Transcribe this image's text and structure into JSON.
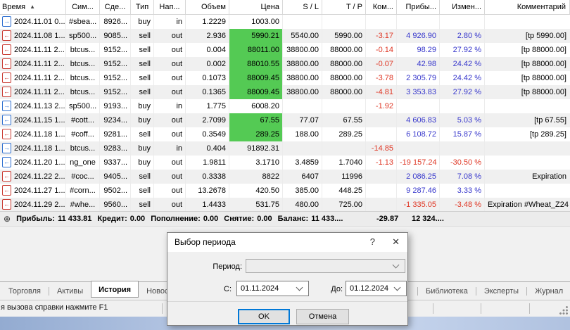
{
  "colors": {
    "green_highlight": "#54ca54",
    "negative_text": "#df3826",
    "positive_text": "#3838cc",
    "buy_icon": "#2e6fd0",
    "sell_icon": "#c93a31",
    "ok_button_border": "#0078d7"
  },
  "table": {
    "sort_indicator": "▲",
    "columns": [
      {
        "key": "time",
        "label": "Время"
      },
      {
        "key": "symbol",
        "label": "Сим..."
      },
      {
        "key": "deal",
        "label": "Сде..."
      },
      {
        "key": "type",
        "label": "Тип"
      },
      {
        "key": "direction",
        "label": "Нап..."
      },
      {
        "key": "volume",
        "label": "Объем"
      },
      {
        "key": "price",
        "label": "Цена"
      },
      {
        "key": "sl",
        "label": "S / L"
      },
      {
        "key": "tp",
        "label": "T / P"
      },
      {
        "key": "commission",
        "label": "Ком..."
      },
      {
        "key": "profit",
        "label": "Прибы..."
      },
      {
        "key": "change",
        "label": "Измен..."
      },
      {
        "key": "comment",
        "label": "Комментарий"
      }
    ],
    "rows": [
      {
        "icon": "buy-in",
        "time": "2024.11.01 0...",
        "symbol": "#sbea...",
        "deal": "8926...",
        "type": "buy",
        "direction": "in",
        "volume": "1.2229",
        "price": "1003.00",
        "price_green": false,
        "sl": "",
        "tp": "",
        "commission": "",
        "profit": "",
        "change": "",
        "comment": ""
      },
      {
        "icon": "sell-out",
        "time": "2024.11.08 1...",
        "symbol": "sp500...",
        "deal": "9085...",
        "type": "sell",
        "direction": "out",
        "volume": "2.936",
        "price": "5990.21",
        "price_green": true,
        "sl": "5540.00",
        "tp": "5990.00",
        "commission": "-3.17",
        "profit": "4 926.90",
        "change": "2.80 %",
        "comment": "[tp 5990.00]"
      },
      {
        "icon": "sell-out",
        "time": "2024.11.11 2...",
        "symbol": "btcus...",
        "deal": "9152...",
        "type": "sell",
        "direction": "out",
        "volume": "0.004",
        "price": "88011.00",
        "price_green": true,
        "sl": "38800.00",
        "tp": "88000.00",
        "commission": "-0.14",
        "profit": "98.29",
        "change": "27.92 %",
        "comment": "[tp 88000.00]"
      },
      {
        "icon": "sell-out",
        "time": "2024.11.11 2...",
        "symbol": "btcus...",
        "deal": "9152...",
        "type": "sell",
        "direction": "out",
        "volume": "0.002",
        "price": "88010.55",
        "price_green": true,
        "sl": "38800.00",
        "tp": "88000.00",
        "commission": "-0.07",
        "profit": "42.98",
        "change": "24.42 %",
        "comment": "[tp 88000.00]"
      },
      {
        "icon": "sell-out",
        "time": "2024.11.11 2...",
        "symbol": "btcus...",
        "deal": "9152...",
        "type": "sell",
        "direction": "out",
        "volume": "0.1073",
        "price": "88009.45",
        "price_green": true,
        "sl": "38800.00",
        "tp": "88000.00",
        "commission": "-3.78",
        "profit": "2 305.79",
        "change": "24.42 %",
        "comment": "[tp 88000.00]"
      },
      {
        "icon": "sell-out",
        "time": "2024.11.11 2...",
        "symbol": "btcus...",
        "deal": "9152...",
        "type": "sell",
        "direction": "out",
        "volume": "0.1365",
        "price": "88009.45",
        "price_green": true,
        "sl": "38800.00",
        "tp": "88000.00",
        "commission": "-4.81",
        "profit": "3 353.83",
        "change": "27.92 %",
        "comment": "[tp 88000.00]"
      },
      {
        "icon": "buy-in",
        "time": "2024.11.13 2...",
        "symbol": "sp500...",
        "deal": "9193...",
        "type": "buy",
        "direction": "in",
        "volume": "1.775",
        "price": "6008.20",
        "price_green": false,
        "sl": "",
        "tp": "",
        "commission": "-1.92",
        "profit": "",
        "change": "",
        "comment": ""
      },
      {
        "icon": "buy-out",
        "time": "2024.11.15 1...",
        "symbol": "#cott...",
        "deal": "9234...",
        "type": "buy",
        "direction": "out",
        "volume": "2.7099",
        "price": "67.55",
        "price_green": true,
        "sl": "77.07",
        "tp": "67.55",
        "commission": "",
        "profit": "4 606.83",
        "change": "5.03 %",
        "comment": "[tp 67.55]"
      },
      {
        "icon": "sell-out",
        "time": "2024.11.18 1...",
        "symbol": "#coff...",
        "deal": "9281...",
        "type": "sell",
        "direction": "out",
        "volume": "0.3549",
        "price": "289.25",
        "price_green": true,
        "sl": "188.00",
        "tp": "289.25",
        "commission": "",
        "profit": "6 108.72",
        "change": "15.87 %",
        "comment": "[tp 289.25]"
      },
      {
        "icon": "buy-in",
        "time": "2024.11.18 1...",
        "symbol": "btcus...",
        "deal": "9283...",
        "type": "buy",
        "direction": "in",
        "volume": "0.404",
        "price": "91892.31",
        "price_green": false,
        "sl": "",
        "tp": "",
        "commission": "-14.85",
        "profit": "",
        "change": "",
        "comment": ""
      },
      {
        "icon": "buy-out",
        "time": "2024.11.20 1...",
        "symbol": "ng_one",
        "deal": "9337...",
        "type": "buy",
        "direction": "out",
        "volume": "1.9811",
        "price": "3.1710",
        "price_green": false,
        "sl": "3.4859",
        "tp": "1.7040",
        "commission": "-1.13",
        "profit": "-19 157.24",
        "change": "-30.50 %",
        "comment": ""
      },
      {
        "icon": "sell-out",
        "time": "2024.11.22 2...",
        "symbol": "#coc...",
        "deal": "9405...",
        "type": "sell",
        "direction": "out",
        "volume": "0.3338",
        "price": "8822",
        "price_green": false,
        "sl": "6407",
        "tp": "11996",
        "commission": "",
        "profit": "2 086.25",
        "change": "7.08 %",
        "comment": "Expiration"
      },
      {
        "icon": "sell-out",
        "time": "2024.11.27 1...",
        "symbol": "#corn...",
        "deal": "9502...",
        "type": "sell",
        "direction": "out",
        "volume": "13.2678",
        "price": "420.50",
        "price_green": false,
        "sl": "385.00",
        "tp": "448.25",
        "commission": "",
        "profit": "9 287.46",
        "change": "3.33 %",
        "comment": ""
      },
      {
        "icon": "sell-out",
        "time": "2024.11.29 2...",
        "symbol": "#whe...",
        "deal": "9560...",
        "type": "sell",
        "direction": "out",
        "volume": "1.4433",
        "price": "531.75",
        "price_green": false,
        "sl": "480.00",
        "tp": "725.00",
        "commission": "",
        "profit": "-1 335.05",
        "change": "-3.48 %",
        "comment": "Expiration #Wheat_Z24"
      }
    ]
  },
  "summary": {
    "expand_icon": "⊕",
    "items": [
      {
        "label": "Прибыль:",
        "value": "11 433.81"
      },
      {
        "label": "Кредит:",
        "value": "0.00"
      },
      {
        "label": "Пополнение:",
        "value": "0.00"
      },
      {
        "label": "Снятие:",
        "value": "0.00"
      },
      {
        "label": "Баланс:",
        "value": "11 433...."
      }
    ],
    "commission_total": "-29.87",
    "profit_total": "12 324...."
  },
  "dialog": {
    "title": "Выбор периода",
    "help_button": "?",
    "close_button": "✕",
    "period_label": "Период:",
    "period_value": "",
    "from_label": "С:",
    "from_value": "01.11.2024",
    "to_label": "До:",
    "to_value": "01.12.2024",
    "ok_button": "OK",
    "cancel_button": "Отмена"
  },
  "tabs": {
    "active": "История",
    "left": [
      "Торговля",
      "Активы",
      "История",
      "Новости"
    ],
    "right": [
      "Библиотека",
      "Эксперты",
      "Журнал"
    ]
  },
  "statusbar": {
    "help_text": "я вызова справки нажмите F1"
  }
}
